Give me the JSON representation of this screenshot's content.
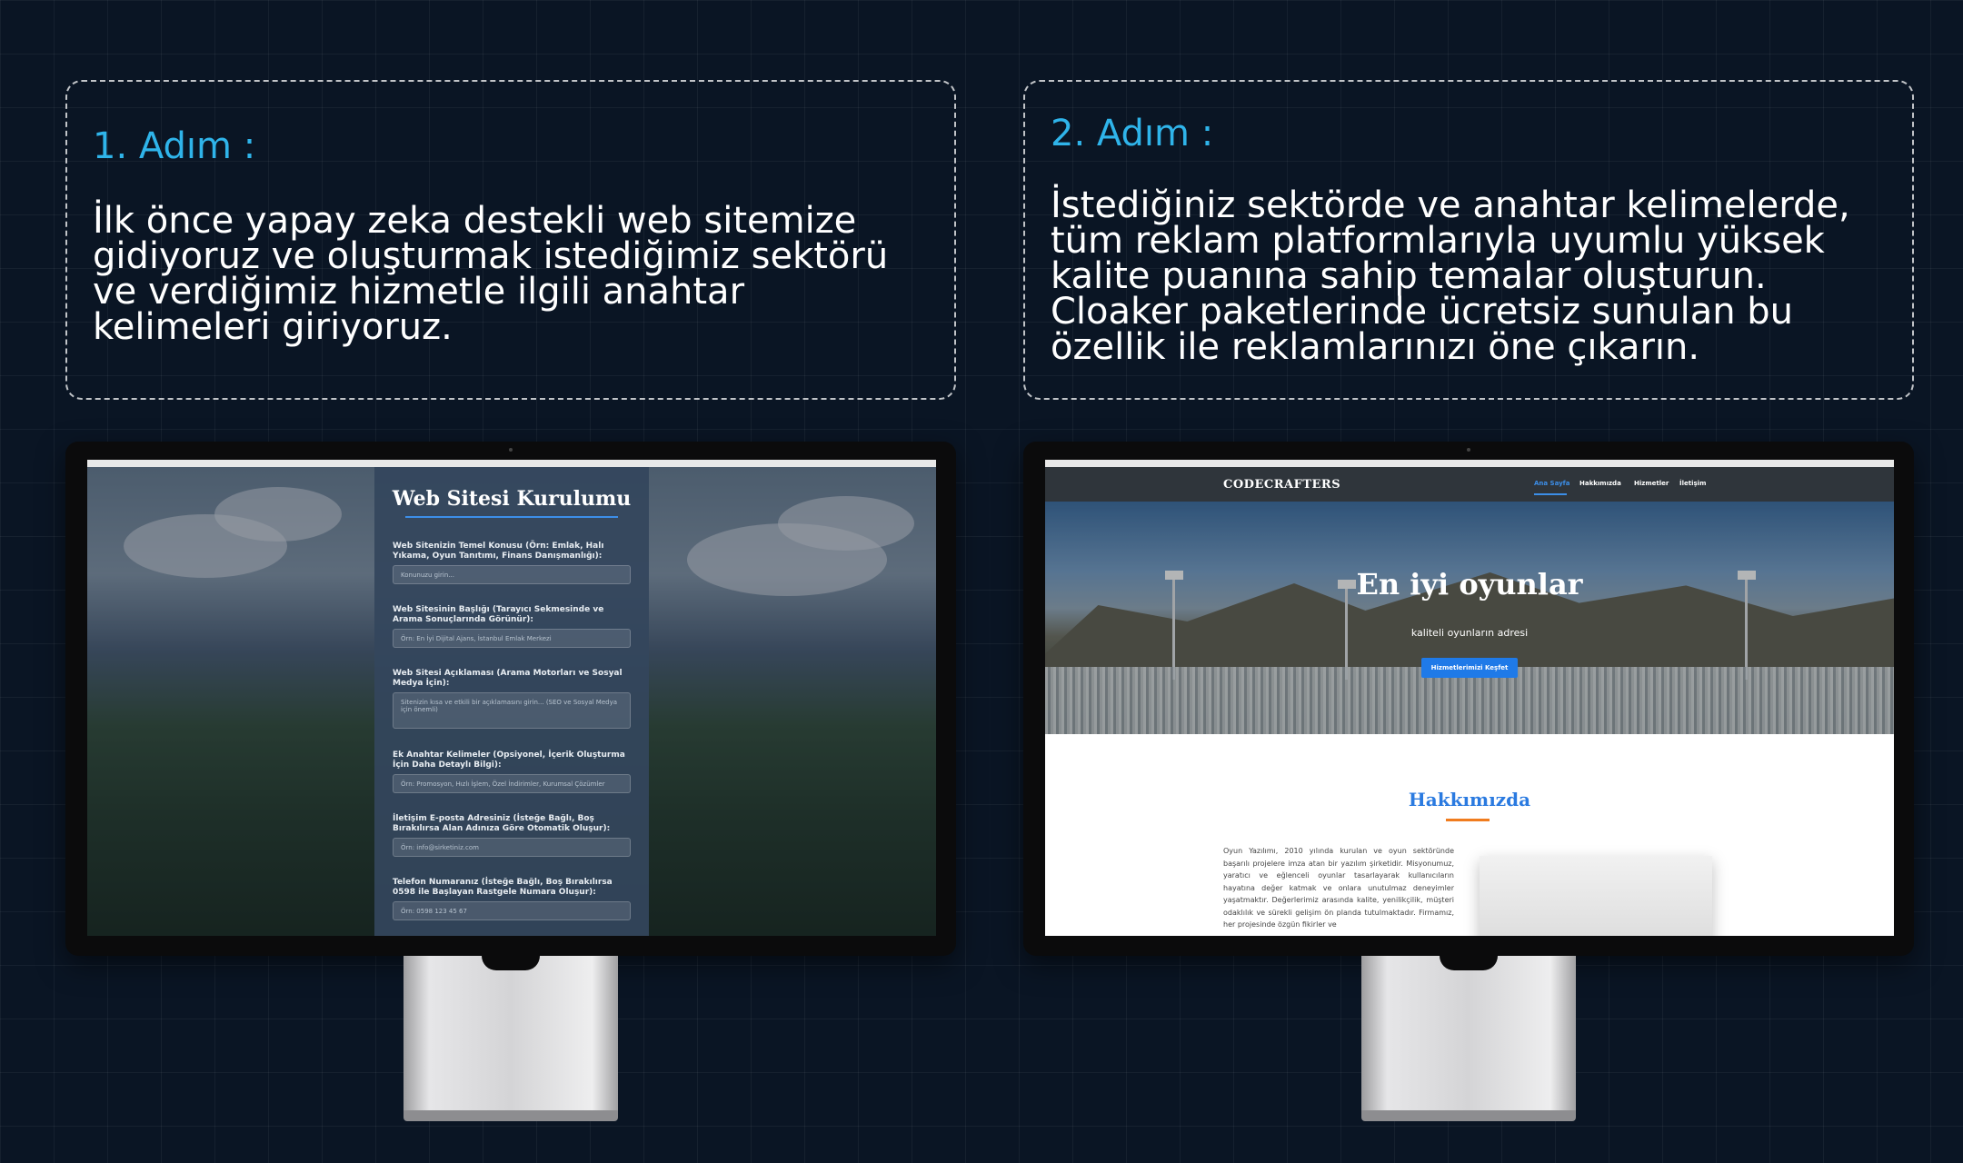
{
  "step1": {
    "title": "1. Adım :",
    "text": "İlk önce yapay zeka destekli web sitemize gidiyoruz ve oluşturmak istediğimiz sektörü ve verdiğimiz hizmetle ilgili anahtar kelimeleri giriyoruz."
  },
  "step2": {
    "title": "2. Adım :",
    "text": "İstediğiniz sektörde ve anahtar kelimelerde, tüm reklam platformlarıyla uyumlu yüksek kalite puanına sahip temalar oluşturun. Cloaker paketlerinde ücretsiz sunulan bu özellik ile reklamlarınızı öne çıkarın."
  },
  "setup_form": {
    "heading": "Web Sitesi Kurulumu",
    "fields": [
      {
        "label": "Web Sitenizin Temel Konusu (Örn: Emlak, Halı Yıkama, Oyun Tanıtımı, Finans Danışmanlığı):",
        "placeholder": "Konunuzu girin..."
      },
      {
        "label": "Web Sitesinin Başlığı (Tarayıcı Sekmesinde ve Arama Sonuçlarında Görünür):",
        "placeholder": "Örn: En İyi Dijital Ajans, İstanbul Emlak Merkezi"
      },
      {
        "label": "Web Sitesi Açıklaması (Arama Motorları ve Sosyal Medya İçin):",
        "placeholder": "Sitenizin kısa ve etkili bir açıklamasını girin... (SEO ve Sosyal Medya için önemli)"
      },
      {
        "label": "Ek Anahtar Kelimeler (Opsiyonel, İçerik Oluşturma İçin Daha Detaylı Bilgi):",
        "placeholder": "Örn: Promosyon, Hızlı İşlem, Özel İndirimler, Kurumsal Çözümler"
      },
      {
        "label": "İletişim E-posta Adresiniz (İsteğe Bağlı, Boş Bırakılırsa Alan Adınıza Göre Otomatik Oluşur):",
        "placeholder": "Örn: info@sirketiniz.com"
      },
      {
        "label": "Telefon Numaranız (İsteğe Bağlı, Boş Bırakılırsa 0598 ile Başlayan Rastgele Numara Oluşur):",
        "placeholder": "Örn: 0598 123 45 67"
      }
    ]
  },
  "generated_site": {
    "brand": "CODECRAFTERS",
    "nav": [
      "Ana Sayfa",
      "Hakkımızda",
      "Hizmetler",
      "İletişim"
    ],
    "hero_title": "En iyi oyunlar",
    "hero_subtitle": "kaliteli oyunların adresi",
    "hero_button": "Hizmetlerimizi Keşfet",
    "about_title": "Hakkımızda",
    "about_text": "Oyun Yazılımı, 2010 yılında kurulan ve oyun sektöründe başarılı projelere imza atan bir yazılım şirketidir. Misyonumuz, yaratıcı ve eğlenceli oyunlar tasarlayarak kullanıcıların hayatına değer katmak ve onlara unutulmaz deneyimler yaşatmaktır. Değerlerimiz arasında kalite, yenilikçilik, müşteri odaklılık ve sürekli gelişim ön planda tutulmaktadır. Firmamız, her projesinde özgün fikirler ve"
  },
  "colors": {
    "accent_cyan": "#2fb4ea",
    "background": "#0a1524",
    "link_blue": "#3c8ee8",
    "orange": "#f07c1e"
  }
}
